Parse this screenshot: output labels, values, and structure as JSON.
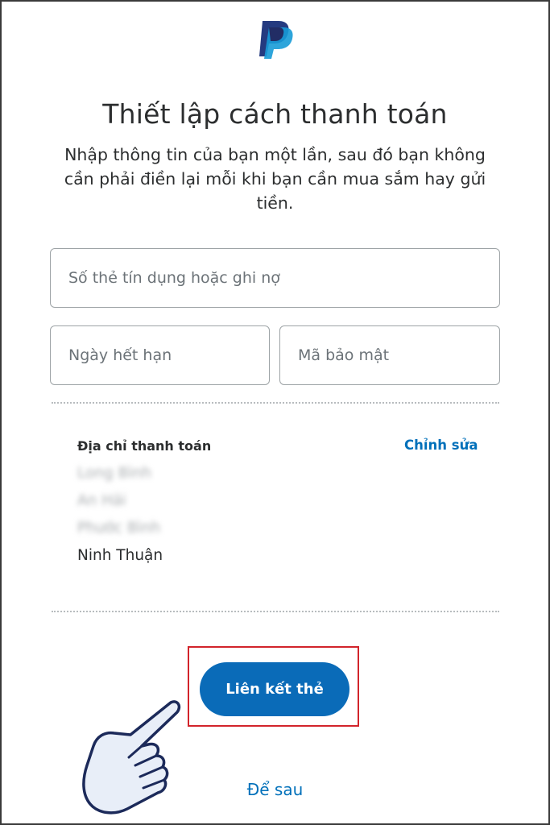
{
  "logo": {
    "icon": "paypal-logo-icon",
    "colors": {
      "dark": "#253b80",
      "light": "#179bd7"
    }
  },
  "header": {
    "title": "Thiết lập cách thanh toán",
    "subtitle": "Nhập thông tin của bạn một lần, sau đó bạn không cần phải điền lại mỗi khi bạn cần mua sắm hay gửi tiền."
  },
  "card_form": {
    "card_number": {
      "placeholder": "Số thẻ tín dụng hoặc ghi nợ",
      "value": ""
    },
    "expiry": {
      "placeholder": "Ngày hết hạn",
      "value": ""
    },
    "security_code": {
      "placeholder": "Mã bảo mật",
      "value": ""
    }
  },
  "billing_address": {
    "label": "Địa chỉ thanh toán",
    "edit_label": "Chỉnh sửa",
    "lines": [
      "Long Bình",
      "An Hải",
      "Phước Bình",
      "Ninh Thuận"
    ]
  },
  "actions": {
    "link_card_label": "Liên kết thẻ",
    "later_label": "Để sau"
  },
  "colors": {
    "accent": "#0070ba",
    "button": "#0a6bb8",
    "highlight": "#d2242b"
  }
}
